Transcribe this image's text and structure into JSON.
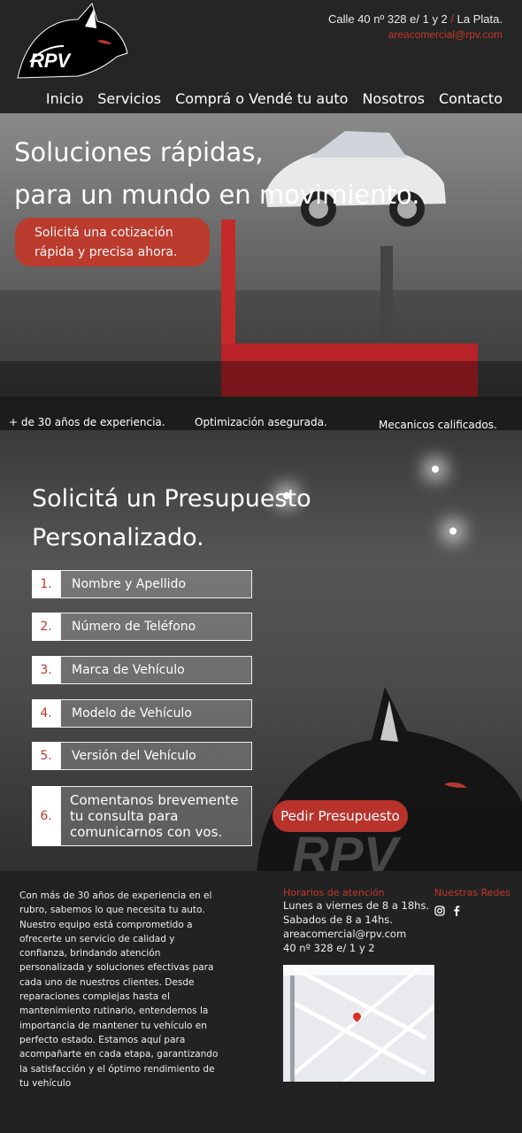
{
  "header": {
    "brand": "RPV",
    "address": "Calle 40 nº 328 e/ 1 y 2",
    "city": "La Plata.",
    "email": "areacomercial@rpv.com",
    "nav": [
      "Inicio",
      "Servicios",
      "Comprá o Vendé tu auto",
      "Nosotros",
      "Contacto"
    ]
  },
  "hero": {
    "title_line1": "Soluciones rápidas,",
    "title_line2": "para un mundo en movimiento.",
    "cta_line1": "Solicitá una cotización",
    "cta_line2": "rápida y precisa ahora."
  },
  "features": [
    "+ de 30 años de experiencia.",
    "Optimización asegurada.",
    "Mecanicos calificados."
  ],
  "form": {
    "title_line1": "Solicitá un Presupuesto",
    "title_line2": "Personalizado.",
    "fields": [
      {
        "num": "1.",
        "label": "Nombre y Apellido"
      },
      {
        "num": "2.",
        "label": "Número de Teléfono"
      },
      {
        "num": "3.",
        "label": "Marca de Vehículo"
      },
      {
        "num": "4.",
        "label": "Modelo de Vehículo"
      },
      {
        "num": "5.",
        "label": "Versión del Vehículo"
      },
      {
        "num": "6.",
        "label_line1": "Comentanos brevemente",
        "label_line2": "tu consulta para",
        "label_line3": "comunicarnos con vos."
      }
    ],
    "submit": "Pedir Presupuesto"
  },
  "footer": {
    "about": "Con más de 30 años de experiencia en el rubro, sabemos lo que necesita tu auto. Nuestro equipo está comprometido a ofrecerte un servicio de calidad y confianza, brindando atención personalizada y soluciones efectivas para cada uno de nuestros clientes. Desde reparaciones complejas hasta el mantenimiento rutinario, entendemos la importancia de mantener tu vehículo en perfecto estado. Estamos aquí para acompañarte en cada etapa, garantizando la satisfacción y el óptimo rendimiento de tu vehículo",
    "hours_title": "Horarios de  atención",
    "hours": [
      "Lunes a viernes de 8 a 18hs.",
      "Sabados de 8 a 14hs.",
      "areacomercial@rpv.com",
      "40 nº 328 e/ 1 y 2"
    ],
    "social_title": "Nuestras Redes"
  },
  "colors": {
    "accent": "#c0392b",
    "background": "#252525"
  }
}
